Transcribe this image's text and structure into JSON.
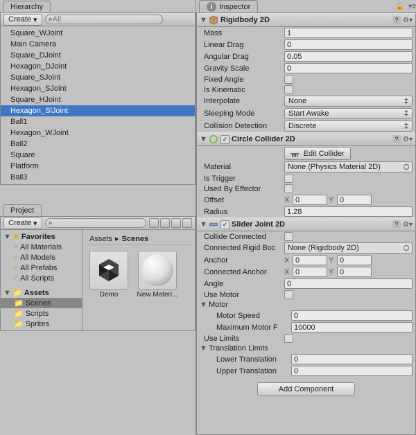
{
  "hierarchy": {
    "tab": "Hierarchy",
    "create": "Create",
    "search_ph": "All",
    "items": [
      "Square_WJoint",
      "Main Camera",
      "Square_DJoint",
      "Hexagon_DJoint",
      "Square_SJoint",
      "Hexagon_SJoint",
      "Square_HJoint",
      "Hexagon_SlJoint",
      "Ball1",
      "Hexagon_WJoint",
      "Ball2",
      "Square",
      "Platform",
      "Ball3"
    ],
    "selected": "Hexagon_SlJoint"
  },
  "project": {
    "tab": "Project",
    "create": "Create",
    "favorites": "Favorites",
    "fav_items": [
      "All Materials",
      "All Models",
      "All Prefabs",
      "All Scripts"
    ],
    "assets": "Assets",
    "asset_items": [
      "Scenes",
      "Scripts",
      "Sprites"
    ],
    "asset_sel": "Scenes",
    "breadcrumb": [
      "Assets",
      "Scenes"
    ],
    "thumbs": [
      {
        "name": "Demo",
        "kind": "unity"
      },
      {
        "name": "New Materi...",
        "kind": "sphere"
      }
    ]
  },
  "inspector": {
    "tab": "Inspector",
    "rigidbody": {
      "title": "Rigidbody 2D",
      "mass": {
        "label": "Mass",
        "value": "1"
      },
      "lindrag": {
        "label": "Linear Drag",
        "value": "0"
      },
      "angdrag": {
        "label": "Angular Drag",
        "value": "0.05"
      },
      "gravscale": {
        "label": "Gravity Scale",
        "value": "0"
      },
      "fixedangle": {
        "label": "Fixed Angle"
      },
      "iskin": {
        "label": "Is Kinematic"
      },
      "interp": {
        "label": "Interpolate",
        "value": "None"
      },
      "sleep": {
        "label": "Sleeping Mode",
        "value": "Start Awake"
      },
      "coll": {
        "label": "Collision Detection",
        "value": "Discrete"
      }
    },
    "circle": {
      "title": "Circle Collider 2D",
      "edit": "Edit Collider",
      "material": {
        "label": "Material",
        "value": "None (Physics Material 2D)"
      },
      "trigger": {
        "label": "Is Trigger"
      },
      "effector": {
        "label": "Used By Effector"
      },
      "offset": {
        "label": "Offset",
        "x": "0",
        "y": "0"
      },
      "radius": {
        "label": "Radius",
        "value": "1.28"
      }
    },
    "slider": {
      "title": "Slider Joint 2D",
      "collconn": {
        "label": "Collide Connected"
      },
      "connbody": {
        "label": "Connected Rigid Boc",
        "value": "None (Rigidbody 2D)"
      },
      "anchor": {
        "label": "Anchor",
        "x": "0",
        "y": "0"
      },
      "connanchor": {
        "label": "Connected Anchor",
        "x": "0",
        "y": "0"
      },
      "angle": {
        "label": "Angle",
        "value": "0"
      },
      "usemotor": {
        "label": "Use Motor"
      },
      "motorhdr": "Motor",
      "motorspeed": {
        "label": "Motor Speed",
        "value": "0"
      },
      "maxforce": {
        "label": "Maximum Motor F",
        "value": "10000"
      },
      "uselimits": {
        "label": "Use Limits"
      },
      "translimits": "Translation Limits",
      "lower": {
        "label": "Lower Translation",
        "value": "0"
      },
      "upper": {
        "label": "Upper Translation",
        "value": "0"
      }
    },
    "addcomp": "Add Component"
  }
}
